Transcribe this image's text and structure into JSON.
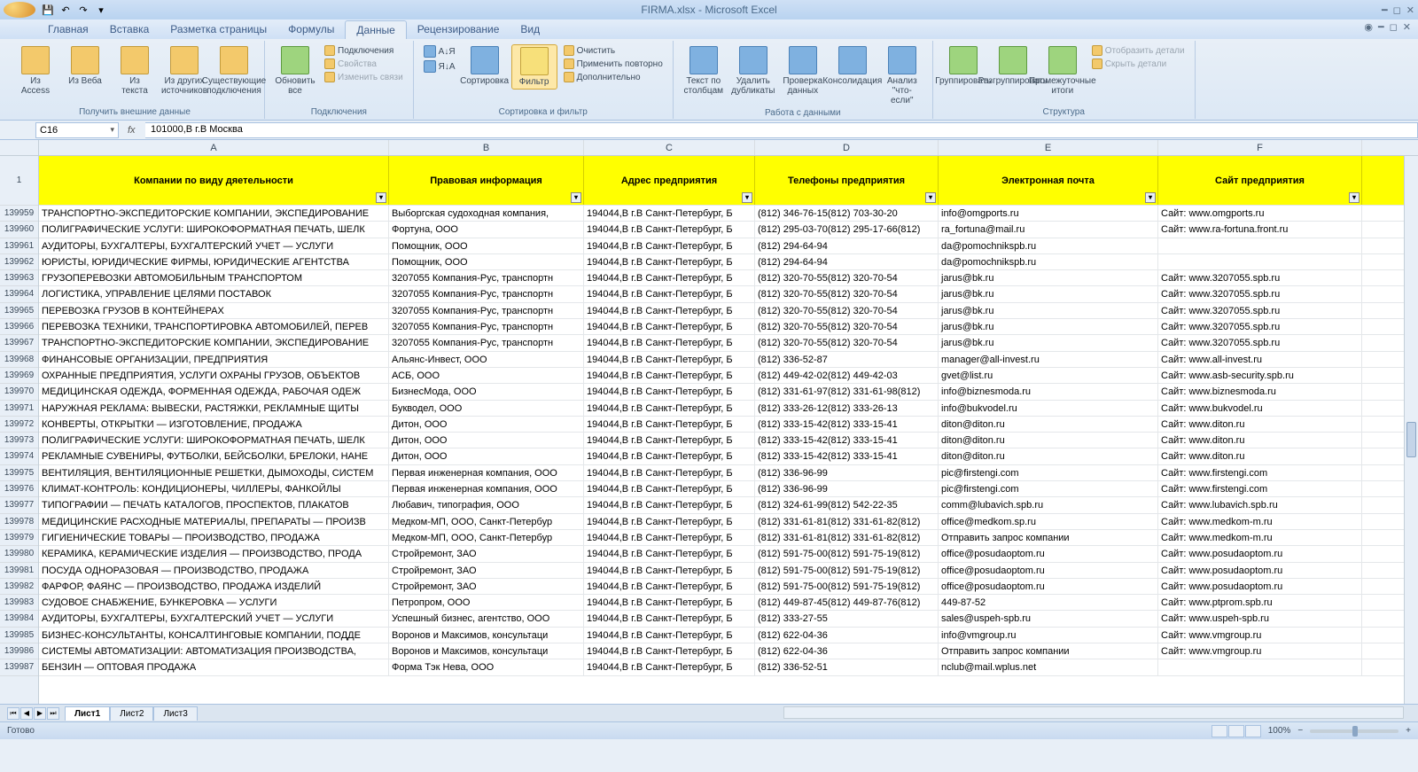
{
  "title": "FIRMA.xlsx - Microsoft Excel",
  "tabs": [
    "Главная",
    "Вставка",
    "Разметка страницы",
    "Формулы",
    "Данные",
    "Рецензирование",
    "Вид"
  ],
  "active_tab_index": 4,
  "ribbon": {
    "g1": {
      "label": "Получить внешние данные",
      "btns": [
        "Из Access",
        "Из Веба",
        "Из текста",
        "Из других источников",
        "Существующие подключения"
      ]
    },
    "g2": {
      "label": "Подключения",
      "main": "Обновить все",
      "items": [
        "Подключения",
        "Свойства",
        "Изменить связи"
      ]
    },
    "g3": {
      "label": "Сортировка и фильтр",
      "az": "А↓Я",
      "za": "Я↓А",
      "sort": "Сортировка",
      "filter": "Фильтр",
      "items": [
        "Очистить",
        "Применить повторно",
        "Дополнительно"
      ]
    },
    "g4": {
      "label": "Работа с данными",
      "btns": [
        "Текст по столбцам",
        "Удалить дубликаты",
        "Проверка данных",
        "Консолидация",
        "Анализ \"что-если\""
      ]
    },
    "g5": {
      "label": "Структура",
      "btns": [
        "Группировать",
        "Разгруппировать",
        "Промежуточные итоги"
      ],
      "items": [
        "Отобразить детали",
        "Скрыть детали"
      ]
    }
  },
  "name_box": "C16",
  "formula": "101000,В г.В Москва",
  "columns": [
    "A",
    "B",
    "C",
    "D",
    "E",
    "F"
  ],
  "header_row_num": "1",
  "headers": [
    "Компании по виду дяетельности",
    "Правовая информация",
    "Адрес предприятия",
    "Телефоны предприятия",
    "Электронная почта",
    "Сайт предприятия"
  ],
  "rows": [
    {
      "n": "139959",
      "c": [
        "ТРАНСПОРТНО-ЭКСПЕДИТОРСКИЕ КОМПАНИИ, ЭКСПЕДИРОВАНИЕ",
        "Выборгская судоходная компания,",
        "194044,В г.В Санкт-Петербург, Б",
        "(812) 346-76-15(812) 703-30-20",
        "info@omgports.ru",
        "Сайт: www.omgports.ru"
      ]
    },
    {
      "n": "139960",
      "c": [
        "ПОЛИГРАФИЧЕСКИЕ УСЛУГИ: ШИРОКОФОРМАТНАЯ ПЕЧАТЬ, ШЕЛК",
        "Фортуна, ООО",
        "194044,В г.В Санкт-Петербург, Б",
        "(812) 295-03-70(812) 295-17-66(812)",
        "ra_fortuna@mail.ru",
        "Сайт: www.ra-fortuna.front.ru"
      ]
    },
    {
      "n": "139961",
      "c": [
        "АУДИТОРЫ, БУХГАЛТЕРЫ, БУХГАЛТЕРСКИЙ УЧЕТ — УСЛУГИ",
        "Помощник, ООО",
        "194044,В г.В Санкт-Петербург, Б",
        "(812) 294-64-94",
        "da@pomochnikspb.ru",
        ""
      ]
    },
    {
      "n": "139962",
      "c": [
        "ЮРИСТЫ, ЮРИДИЧЕСКИЕ ФИРМЫ, ЮРИДИЧЕСКИЕ АГЕНТСТВА",
        "Помощник, ООО",
        "194044,В г.В Санкт-Петербург, Б",
        "(812) 294-64-94",
        "da@pomochnikspb.ru",
        ""
      ]
    },
    {
      "n": "139963",
      "c": [
        "ГРУЗОПЕРЕВОЗКИ АВТОМОБИЛЬНЫМ ТРАНСПОРТОМ",
        "3207055 Компания-Рус, транспортн",
        "194044,В г.В Санкт-Петербург, Б",
        "(812) 320-70-55(812) 320-70-54",
        "jarus@bk.ru",
        "Сайт: www.3207055.spb.ru"
      ]
    },
    {
      "n": "139964",
      "c": [
        "ЛОГИСТИКА, УПРАВЛЕНИЕ ЦЕЛЯМИ ПОСТАВОК",
        "3207055 Компания-Рус, транспортн",
        "194044,В г.В Санкт-Петербург, Б",
        "(812) 320-70-55(812) 320-70-54",
        "jarus@bk.ru",
        "Сайт: www.3207055.spb.ru"
      ]
    },
    {
      "n": "139965",
      "c": [
        "ПЕРЕВОЗКА ГРУЗОВ В КОНТЕЙНЕРАХ",
        "3207055 Компания-Рус, транспортн",
        "194044,В г.В Санкт-Петербург, Б",
        "(812) 320-70-55(812) 320-70-54",
        "jarus@bk.ru",
        "Сайт: www.3207055.spb.ru"
      ]
    },
    {
      "n": "139966",
      "c": [
        "ПЕРЕВОЗКА ТЕХНИКИ, ТРАНСПОРТИРОВКА АВТОМОБИЛЕЙ, ПЕРЕВ",
        "3207055 Компания-Рус, транспортн",
        "194044,В г.В Санкт-Петербург, Б",
        "(812) 320-70-55(812) 320-70-54",
        "jarus@bk.ru",
        "Сайт: www.3207055.spb.ru"
      ]
    },
    {
      "n": "139967",
      "c": [
        "ТРАНСПОРТНО-ЭКСПЕДИТОРСКИЕ КОМПАНИИ, ЭКСПЕДИРОВАНИЕ",
        "3207055 Компания-Рус, транспортн",
        "194044,В г.В Санкт-Петербург, Б",
        "(812) 320-70-55(812) 320-70-54",
        "jarus@bk.ru",
        "Сайт: www.3207055.spb.ru"
      ]
    },
    {
      "n": "139968",
      "c": [
        "ФИНАНСОВЫЕ ОРГАНИЗАЦИИ, ПРЕДПРИЯТИЯ",
        "Альянс-Инвест, ООО",
        "194044,В г.В Санкт-Петербург, Б",
        "(812) 336-52-87",
        "manager@all-invest.ru",
        "Сайт: www.all-invest.ru"
      ]
    },
    {
      "n": "139969",
      "c": [
        "ОХРАННЫЕ ПРЕДПРИЯТИЯ, УСЛУГИ ОХРАНЫ ГРУЗОВ, ОБЪЕКТОВ",
        "АСБ, ООО",
        "194044,В г.В Санкт-Петербург, Б",
        "(812) 449-42-02(812) 449-42-03",
        "gvet@list.ru",
        "Сайт: www.asb-security.spb.ru"
      ]
    },
    {
      "n": "139970",
      "c": [
        "МЕДИЦИНСКАЯ ОДЕЖДА, ФОРМЕННАЯ ОДЕЖДА, РАБОЧАЯ ОДЕЖ",
        "БизнесМода, ООО",
        "194044,В г.В Санкт-Петербург, Б",
        "(812) 331-61-97(812) 331-61-98(812)",
        "info@biznesmoda.ru",
        "Сайт: www.biznesmoda.ru"
      ]
    },
    {
      "n": "139971",
      "c": [
        "НАРУЖНАЯ РЕКЛАМА: ВЫВЕСКИ, РАСТЯЖКИ, РЕКЛАМНЫЕ ЩИТЫ",
        "Букводел, ООО",
        "194044,В г.В Санкт-Петербург, Б",
        "(812) 333-26-12(812) 333-26-13",
        "info@bukvodel.ru",
        "Сайт: www.bukvodel.ru"
      ]
    },
    {
      "n": "139972",
      "c": [
        "КОНВЕРТЫ, ОТКРЫТКИ — ИЗГОТОВЛЕНИЕ, ПРОДАЖА",
        "Дитон, ООО",
        "194044,В г.В Санкт-Петербург, Б",
        "(812) 333-15-42(812) 333-15-41",
        "diton@diton.ru",
        "Сайт: www.diton.ru"
      ]
    },
    {
      "n": "139973",
      "c": [
        "ПОЛИГРАФИЧЕСКИЕ УСЛУГИ: ШИРОКОФОРМАТНАЯ ПЕЧАТЬ, ШЕЛК",
        "Дитон, ООО",
        "194044,В г.В Санкт-Петербург, Б",
        "(812) 333-15-42(812) 333-15-41",
        "diton@diton.ru",
        "Сайт: www.diton.ru"
      ]
    },
    {
      "n": "139974",
      "c": [
        "РЕКЛАМНЫЕ СУВЕНИРЫ, ФУТБОЛКИ, БЕЙСБОЛКИ, БРЕЛОКИ, НАНЕ",
        "Дитон, ООО",
        "194044,В г.В Санкт-Петербург, Б",
        "(812) 333-15-42(812) 333-15-41",
        "diton@diton.ru",
        "Сайт: www.diton.ru"
      ]
    },
    {
      "n": "139975",
      "c": [
        "ВЕНТИЛЯЦИЯ, ВЕНТИЛЯЦИОННЫЕ РЕШЕТКИ, ДЫМОХОДЫ, СИСТЕМ",
        "Первая инженерная компания, ООО",
        "194044,В г.В Санкт-Петербург, Б",
        "(812) 336-96-99",
        "pic@firstengi.com",
        "Сайт: www.firstengi.com"
      ]
    },
    {
      "n": "139976",
      "c": [
        "КЛИМАТ-КОНТРОЛЬ: КОНДИЦИОНЕРЫ, ЧИЛЛЕРЫ, ФАНКОЙЛЫ",
        "Первая инженерная компания, ООО",
        "194044,В г.В Санкт-Петербург, Б",
        "(812) 336-96-99",
        "pic@firstengi.com",
        "Сайт: www.firstengi.com"
      ]
    },
    {
      "n": "139977",
      "c": [
        "ТИПОГРАФИИ — ПЕЧАТЬ КАТАЛОГОВ, ПРОСПЕКТОВ, ПЛАКАТОВ",
        "Любавич, типография, ООО",
        "194044,В г.В Санкт-Петербург, Б",
        "(812) 324-61-99(812) 542-22-35",
        "comm@lubavich.spb.ru",
        "Сайт: www.lubavich.spb.ru"
      ]
    },
    {
      "n": "139978",
      "c": [
        "МЕДИЦИНСКИЕ РАСХОДНЫЕ МАТЕРИАЛЫ, ПРЕПАРАТЫ — ПРОИЗВ",
        "Медком-МП, ООО, Санкт-Петербур",
        "194044,В г.В Санкт-Петербург, Б",
        "(812) 331-61-81(812) 331-61-82(812)",
        "office@medkom.sp.ru",
        "Сайт: www.medkom-m.ru"
      ]
    },
    {
      "n": "139979",
      "c": [
        "ГИГИЕНИЧЕСКИЕ ТОВАРЫ — ПРОИЗВОДСТВО, ПРОДАЖА",
        "Медком-МП, ООО, Санкт-Петербур",
        "194044,В г.В Санкт-Петербург, Б",
        "(812) 331-61-81(812) 331-61-82(812)",
        "Отправить запрос компании",
        "Сайт: www.medkom-m.ru"
      ]
    },
    {
      "n": "139980",
      "c": [
        "КЕРАМИКА, КЕРАМИЧЕСКИЕ ИЗДЕЛИЯ — ПРОИЗВОДСТВО, ПРОДА",
        "Стройремонт, ЗАО",
        "194044,В г.В Санкт-Петербург, Б",
        "(812) 591-75-00(812) 591-75-19(812)",
        "office@posudaoptom.ru",
        "Сайт: www.posudaoptom.ru"
      ]
    },
    {
      "n": "139981",
      "c": [
        "ПОСУДА ОДНОРАЗОВАЯ — ПРОИЗВОДСТВО, ПРОДАЖА",
        "Стройремонт, ЗАО",
        "194044,В г.В Санкт-Петербург, Б",
        "(812) 591-75-00(812) 591-75-19(812)",
        "office@posudaoptom.ru",
        "Сайт: www.posudaoptom.ru"
      ]
    },
    {
      "n": "139982",
      "c": [
        "ФАРФОР, ФАЯНС — ПРОИЗВОДСТВО, ПРОДАЖА ИЗДЕЛИЙ",
        "Стройремонт, ЗАО",
        "194044,В г.В Санкт-Петербург, Б",
        "(812) 591-75-00(812) 591-75-19(812)",
        "office@posudaoptom.ru",
        "Сайт: www.posudaoptom.ru"
      ]
    },
    {
      "n": "139983",
      "c": [
        "СУДОВОЕ СНАБЖЕНИЕ, БУНКЕРОВКА — УСЛУГИ",
        "Петропром, ООО",
        "194044,В г.В Санкт-Петербург, Б",
        "(812) 449-87-45(812) 449-87-76(812)",
        "449-87-52",
        "Сайт: www.ptprom.spb.ru"
      ]
    },
    {
      "n": "139984",
      "c": [
        "АУДИТОРЫ, БУХГАЛТЕРЫ, БУХГАЛТЕРСКИЙ УЧЕТ — УСЛУГИ",
        "Успешный бизнес, агентство, ООО",
        "194044,В г.В Санкт-Петербург, Б",
        "(812) 333-27-55",
        "sales@uspeh-spb.ru",
        "Сайт: www.uspeh-spb.ru"
      ]
    },
    {
      "n": "139985",
      "c": [
        "БИЗНЕС-КОНСУЛЬТАНТЫ, КОНСАЛТИНГОВЫЕ КОМПАНИИ, ПОДДЕ",
        "Воронов и Максимов, консультаци",
        "194044,В г.В Санкт-Петербург, Б",
        "(812) 622-04-36",
        "info@vmgroup.ru",
        "Сайт: www.vmgroup.ru"
      ]
    },
    {
      "n": "139986",
      "c": [
        "СИСТЕМЫ АВТОМАТИЗАЦИИ: АВТОМАТИЗАЦИЯ ПРОИЗВОДСТВА,",
        "Воронов и Максимов, консультаци",
        "194044,В г.В Санкт-Петербург, Б",
        "(812) 622-04-36",
        "Отправить запрос компании",
        "Сайт: www.vmgroup.ru"
      ]
    },
    {
      "n": "139987",
      "c": [
        "БЕНЗИН — ОПТОВАЯ ПРОДАЖА",
        "Форма Тэк Нева, ООО",
        "194044,В г.В Санкт-Петербург, Б",
        "(812) 336-52-51",
        "nclub@mail.wplus.net",
        ""
      ]
    }
  ],
  "sheet_tabs": [
    "Лист1",
    "Лист2",
    "Лист3"
  ],
  "active_sheet": 0,
  "status": "Готово",
  "zoom": "100%"
}
